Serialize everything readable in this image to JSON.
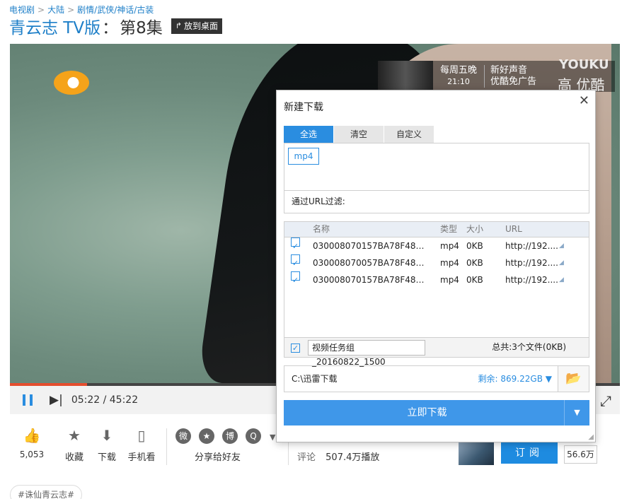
{
  "breadcrumb": [
    "电视剧",
    "大陆",
    "剧情/武侠/神话/古装"
  ],
  "title": {
    "main": "青云志 TV版",
    "colon": "：",
    "episode": "第8集",
    "desktop_button": "放到桌面"
  },
  "video": {
    "promo_day": "每周五晚",
    "promo_time": "21:10",
    "promo_line1": "新好声音",
    "promo_line2": "优酷免广告",
    "watermark": "YOUKU",
    "watermark2": "高 优酷",
    "progress": 0.126
  },
  "controls": {
    "time": "05:22 / 45:22"
  },
  "actions": {
    "like_count": "5,053",
    "favorite": "收藏",
    "download": "下载",
    "mobile": "手机看",
    "share": "分享给好友"
  },
  "stats": {
    "comments": "评论",
    "plays": "507.4万播放"
  },
  "channel": {
    "subscribe": "订阅",
    "subscribers": "56.6万"
  },
  "tag": "#诛仙青云志#",
  "dialog": {
    "title": "新建下载",
    "tabs": [
      "全选",
      "清空",
      "自定义"
    ],
    "ext_tag": "mp4",
    "url_filter": "通过URL过滤:",
    "columns": {
      "name": "名称",
      "type": "类型",
      "size": "大小",
      "url": "URL"
    },
    "rows": [
      {
        "name": "030008070157BA78F48613...",
        "type": "mp4",
        "size": "0KB",
        "url": "http://192...."
      },
      {
        "name": "030008070057BA78F48613...",
        "type": "mp4",
        "size": "0KB",
        "url": "http://192...."
      },
      {
        "name": "030008070157BA78F48613...",
        "type": "mp4",
        "size": "0KB",
        "url": "http://192...."
      }
    ],
    "group_name": "视频任务组_20160822_1500",
    "total": "总共:3个文件(0KB)",
    "save_path": "C:\\迅雷下载",
    "free_space": "剩余: 869.22GB",
    "download_now": "立即下载"
  }
}
